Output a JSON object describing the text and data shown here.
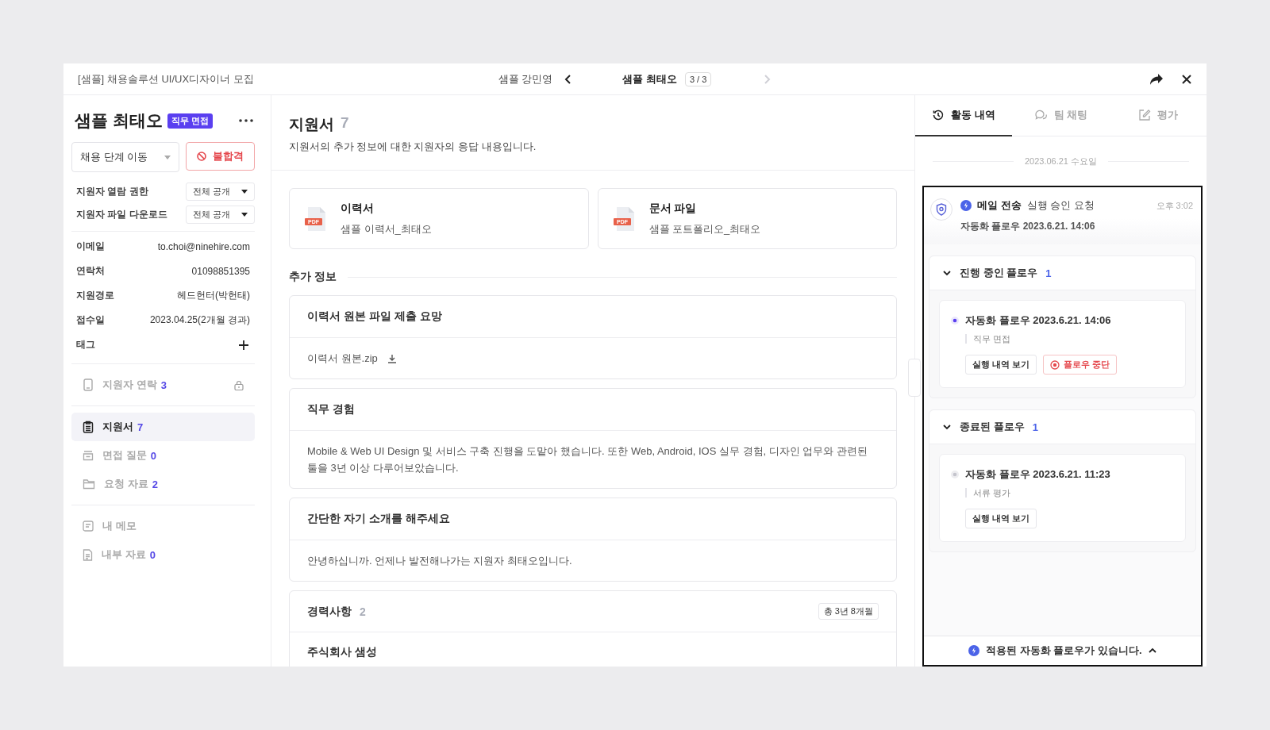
{
  "header": {
    "job_title": "[샘플] 채용솔루션 UI/UX디자이너 모집",
    "prev_applicant": "샘플 강민영",
    "prev_disabled": false,
    "current_applicant": "샘플 최태오",
    "position": "3 / 3",
    "next_disabled": true
  },
  "profile": {
    "name": "샘플 최태오",
    "stage_badge": "직무 면접",
    "stage_select": "채용 단계 이동",
    "reject_button": "불합격",
    "permissions": [
      {
        "label": "지원자 열람 권한",
        "value": "전체 공개"
      },
      {
        "label": "지원자 파일 다운로드",
        "value": "전체 공개"
      }
    ],
    "fields": [
      {
        "label": "이메일",
        "value": "to.choi@ninehire.com"
      },
      {
        "label": "연락처",
        "value": "01098851395"
      },
      {
        "label": "지원경로",
        "value": "헤드헌터(박헌태)"
      },
      {
        "label": "접수일",
        "value": "2023.04.25(2개월 경과)"
      }
    ],
    "tag_label": "태그"
  },
  "sidebar": {
    "groups": [
      {
        "items": [
          {
            "kind": "phone",
            "label": "지원자 연락",
            "count": "3",
            "locked": true,
            "selected": false
          }
        ]
      },
      {
        "items": [
          {
            "kind": "clipboard",
            "label": "지원서",
            "count": "7",
            "locked": false,
            "selected": true
          },
          {
            "kind": "tray",
            "label": "면접 질문",
            "count": "0",
            "locked": false,
            "selected": false
          },
          {
            "kind": "folder",
            "label": "요청 자료",
            "count": "2",
            "locked": false,
            "selected": false
          }
        ]
      },
      {
        "items": [
          {
            "kind": "note",
            "label": "내 메모",
            "locked": false,
            "selected": false
          },
          {
            "kind": "document",
            "label": "내부 자료",
            "count": "0",
            "locked": false,
            "selected": false
          }
        ]
      }
    ]
  },
  "application": {
    "title": "지원서",
    "count": "7",
    "description": "지원서의 추가 정보에 대한 지원자의 응답 내용입니다.",
    "files": [
      {
        "title": "이력서",
        "name": "샘플 이력서_최태오",
        "file_type": "PDF"
      },
      {
        "title": "문서 파일",
        "name": "샘플 포트폴리오_최태오",
        "file_type": "PDF"
      }
    ],
    "section_title": "추가 정보",
    "answers": [
      {
        "question": "이력서 원본 파일 제출 요망",
        "kind": "file",
        "answer": "이력서 원본.zip"
      },
      {
        "question": "직무 경험",
        "kind": "text",
        "answer": "Mobile & Web UI Design 및 서비스 구축 진행을 도맡아 했습니다. 또한 Web, Android, IOS 실무 경험, 디자인 업무와 관련된 툴을 3년 이상 다루어보았습니다."
      },
      {
        "question": "간단한 자기 소개를 해주세요",
        "kind": "text",
        "answer": "안녕하십니까. 언제나 발전해나가는 지원자 최태오입니다."
      }
    ],
    "career": {
      "title": "경력사항",
      "count": "2",
      "total": "총 3년 8개월",
      "companies": [
        "주식회사 샘성"
      ]
    }
  },
  "activity": {
    "tabs": [
      {
        "kind": "history",
        "label": "활동 내역",
        "selected": true
      },
      {
        "kind": "chat",
        "label": "팀 채팅",
        "selected": false
      },
      {
        "kind": "edit",
        "label": "평가",
        "selected": false
      }
    ],
    "date": "2023.06.21 수요일",
    "event": {
      "action": "메일 전송",
      "status": "실행 승인 요청",
      "time": "오후 3:02",
      "flow": "자동화 플로우 2023.6.21. 14:06"
    },
    "flow_groups": [
      {
        "title": "진행 중인 플로우",
        "count": "1",
        "expanded": true,
        "flows": [
          {
            "name": "자동화 플로우 2023.6.21. 14:06",
            "stage": "직무 면접",
            "active": true,
            "buttons": [
              {
                "kind": "default",
                "label": "실행 내역 보기"
              },
              {
                "kind": "stop",
                "label": "플로우 중단"
              }
            ]
          }
        ]
      },
      {
        "title": "종료된 플로우",
        "count": "1",
        "expanded": true,
        "flows": [
          {
            "name": "자동화 플로우 2023.6.21. 11:23",
            "stage": "서류 평가",
            "active": false,
            "buttons": [
              {
                "kind": "default",
                "label": "실행 내역 보기"
              }
            ]
          }
        ]
      }
    ],
    "footer": "적용된 자동화 플로우가 있습니다."
  }
}
